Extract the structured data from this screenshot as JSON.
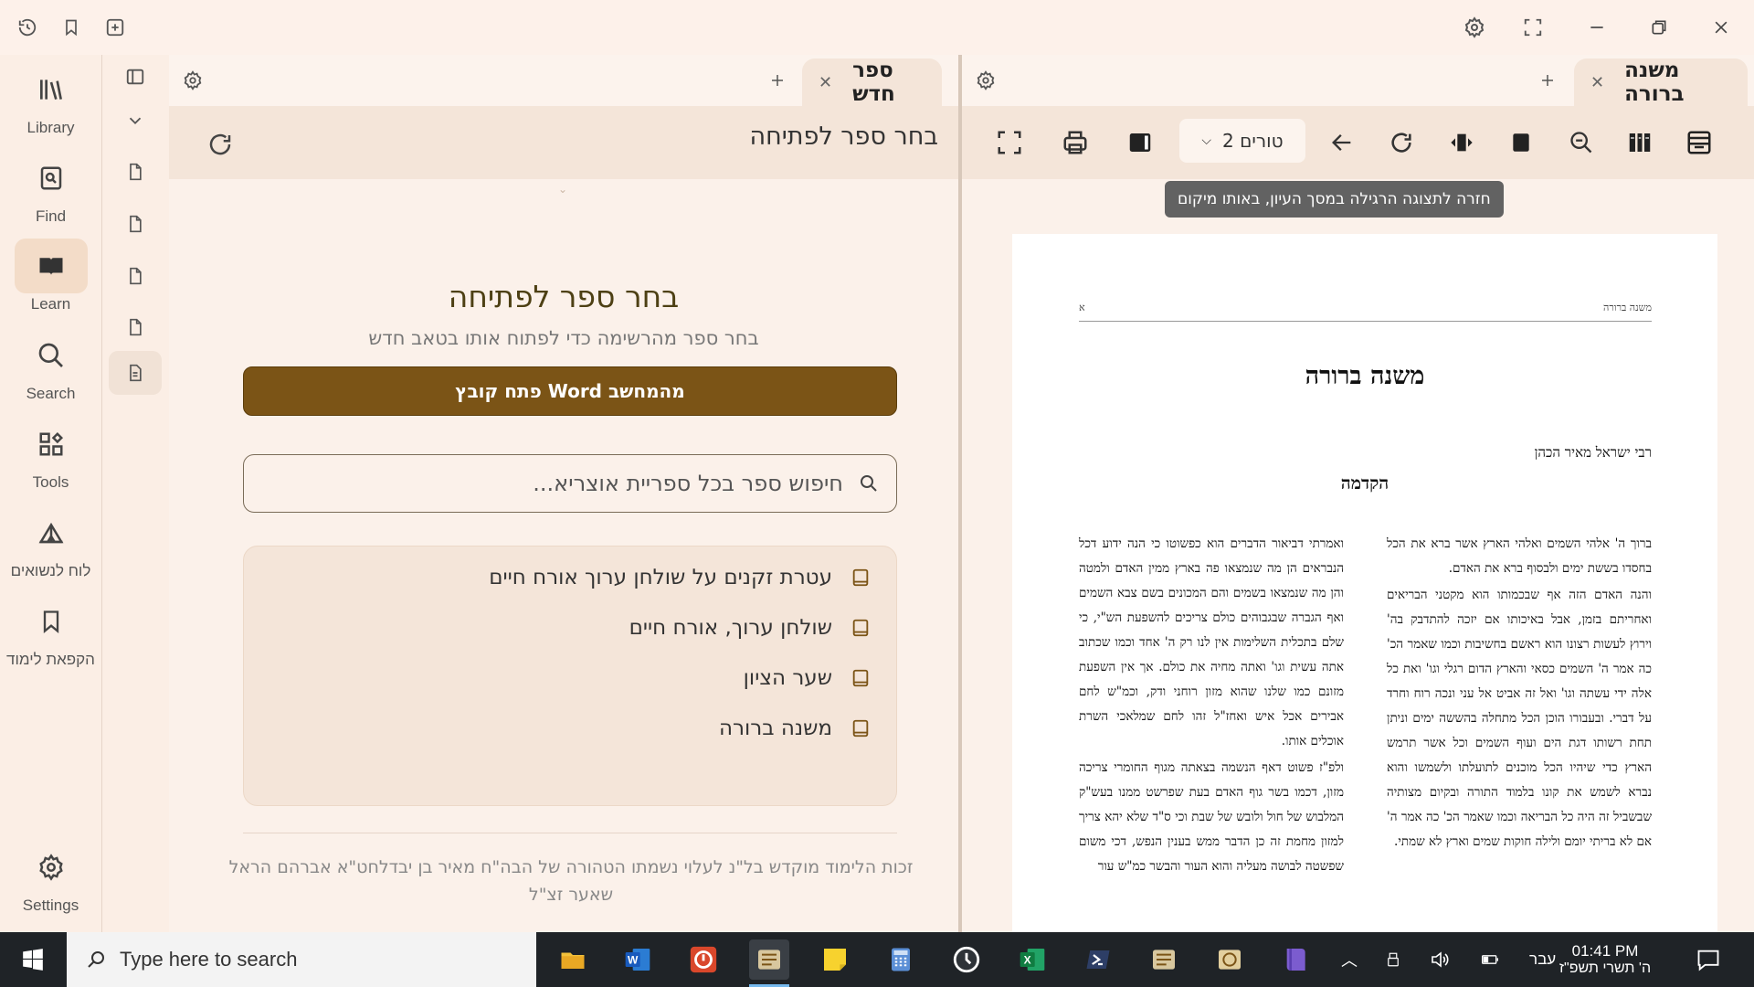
{
  "window": {
    "icons": [
      "history-icon",
      "bookmark-icon",
      "add-tab-icon",
      "settings-icon",
      "fullscreen-icon",
      "minimize-icon",
      "restore-icon",
      "close-icon"
    ]
  },
  "nav": {
    "items": [
      {
        "label": "Library",
        "icon": "library-icon"
      },
      {
        "label": "Find",
        "icon": "find-icon"
      },
      {
        "label": "Learn",
        "icon": "learn-icon",
        "active": true
      },
      {
        "label": "Search",
        "icon": "search-icon"
      },
      {
        "label": "Tools",
        "icon": "tools-icon"
      },
      {
        "label": "לוח לנשואים",
        "icon": "tent-icon"
      },
      {
        "label": "הקפאת לימוד",
        "icon": "bookmark-icon"
      }
    ],
    "settings_label": "Settings"
  },
  "left_pane": {
    "tab_label": "ספר חדש",
    "toolbar_title": "בחר ספר לפתיחה",
    "heading": "בחר ספר לפתיחה",
    "subheading": "בחר ספר מהרשימה כדי לפתוח אותו בטאב חדש",
    "open_button": "פתח קובץ Word מהמחשב",
    "search_placeholder": "חיפוש ספר בכל ספריית אוצריא...",
    "books": [
      "עטרת זקנים על שולחן ערוך אורח חיים",
      "שולחן ערוך, אורח חיים",
      "שער הציון",
      "משנה ברורה"
    ],
    "dedication": "זכות הלימוד מוקדש בל\"נ לעלוי נשמתו הטהורה של הבה\"ח מאיר בן יבדלחט\"א אברהם הראל שאער זצ\"ל"
  },
  "right_pane": {
    "tab_label": "משנה ברורה",
    "columns_label": "2 טורים",
    "tooltip": "חזרה לתצוגה הרגילה במסך העיון, באותו מיקום",
    "page": {
      "header_right": "משנה ברורה",
      "header_left": "א",
      "title": "משנה ברורה",
      "author": "רבי ישראל מאיר הכהן",
      "intro_heading": "הקדמה",
      "col_right": [
        "ברוך ה' אלהי השמים ואלהי הארץ אשר ברא את הכל בחסדו בששת ימים ולבסוף ברא את האדם.",
        "והנה האדם הזה אף שבכמותו הוא מקטני הבריאים ואחריתם בזמן, אבל באיכותו אם יזכה להתדבק בה' וירוץ לעשות רצונו הוא ראשם בחשיבות וכמו שאמר הכ' כה אמר ה' השמים כסאי והארץ הדום רגלי וגו' ואת כל אלה ידי עשתה וגו' ואל זה אביט אל עני ונכה רוח וחרד על דברי. ובעבורו הוכן הכל מתחלה בהששה ימים וניתן תחת רשותו דגת הים ועוף השמים וכל אשר תרמש הארץ כדי שיהיו הכל מוכנים לתועלתו ולשמשו והוא נברא לשמש את קונו בלמוד התורה ובקיום מצותיה שבשביל זה היה כל הבריאה וכמו שאמר הכ' כה אמר ה' אם לא בריתי יומם ולילה חוקות שמים וארץ לא שמתי."
      ],
      "col_left": [
        "ואמרתי דביאור הדברים הוא כפשוטו כי הנה ידוע דכל הנבראים הן מה שנמצאו פה בארץ ממין האדם ולמטה והן מה שנמצאו בשמים והם המכונים בשם צבא השמים ואף הגברה שבגבוהים כולם צריכים להשפעת הש\"י, כי שלם בתכלית השלימות אין לנו רק ה' אחד וכמו שכתוב אתה עשית וגו' ואתה מחיה את כולם. אך אין השפעת מזונם כמו שלנו שהוא מזון רוחני ודק, וכמ\"ש לחם אבירים אכל איש ואחז\"ל זהו לחם שמלאכי השרת אוכלים אותו.",
        "ולפ\"ז פשוט דאף הנשמה בצאתה מגוף החומרי צריכה מזון, דכמו בשר גוף האדם בעת שפרשט ממנו בעש\"ק המלבוש של חול ולובש של שבת וכי ס\"ד שלא יהא צריך למזון מחמת זה כן הדבר ממש בענין הנפש, דכי משום שפשטה לבושה מעליה והוא העור והבשר כמ\"ש עור"
      ]
    }
  },
  "taskbar": {
    "search_placeholder": "Type here to search",
    "language": "עבר",
    "time": "01:41 PM",
    "date": "ה' תשרי תשפ\"ז"
  }
}
